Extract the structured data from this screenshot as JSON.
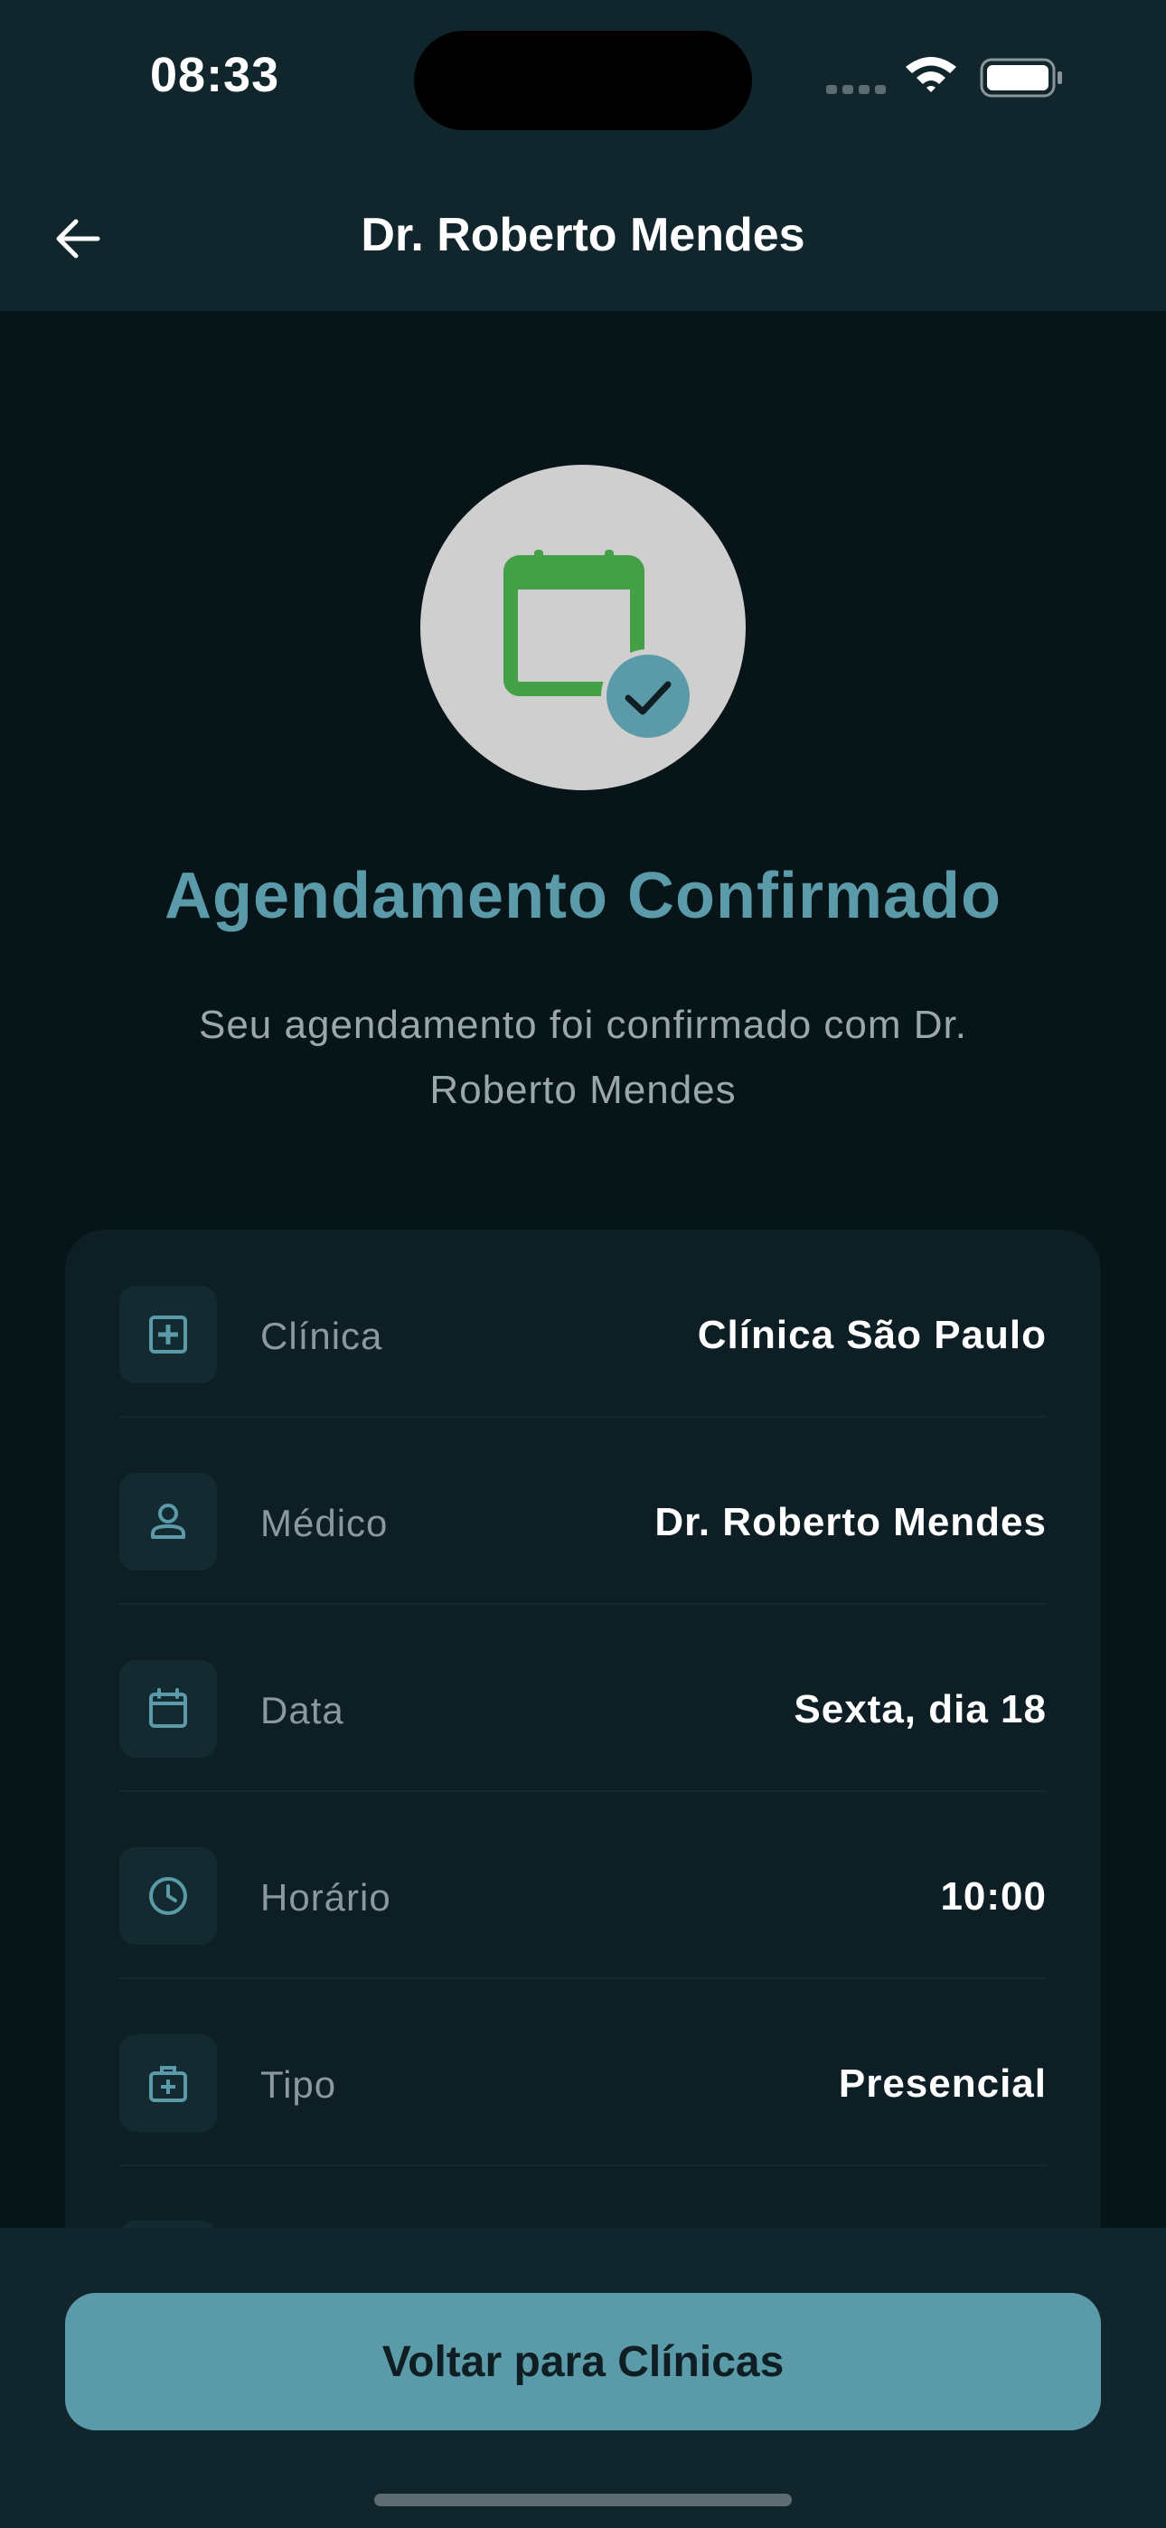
{
  "status_bar": {
    "time": "08:33"
  },
  "app_bar": {
    "title": "Dr. Roberto Mendes",
    "back_icon": "arrow-left-icon"
  },
  "confirmation": {
    "icon": "calendar-check-icon",
    "title": "Agendamento Confirmado",
    "subtitle": "Seu agendamento foi confirmado com Dr. Roberto Mendes"
  },
  "details": [
    {
      "icon": "medical-plus-icon",
      "label": "Clínica",
      "value": "Clínica São Paulo"
    },
    {
      "icon": "person-icon",
      "label": "Médico",
      "value": "Dr. Roberto Mendes"
    },
    {
      "icon": "calendar-icon",
      "label": "Data",
      "value": "Sexta, dia 18"
    },
    {
      "icon": "clock-icon",
      "label": "Horário",
      "value": "10:00"
    },
    {
      "icon": "medical-bag-icon",
      "label": "Tipo",
      "value": "Presencial"
    }
  ],
  "actions": {
    "back_to_clinics": "Voltar para Clínicas"
  },
  "colors": {
    "accent": "#5b9aa8",
    "background": "#071519",
    "surface": "#0d1e24",
    "calendar_green": "#43a047"
  }
}
